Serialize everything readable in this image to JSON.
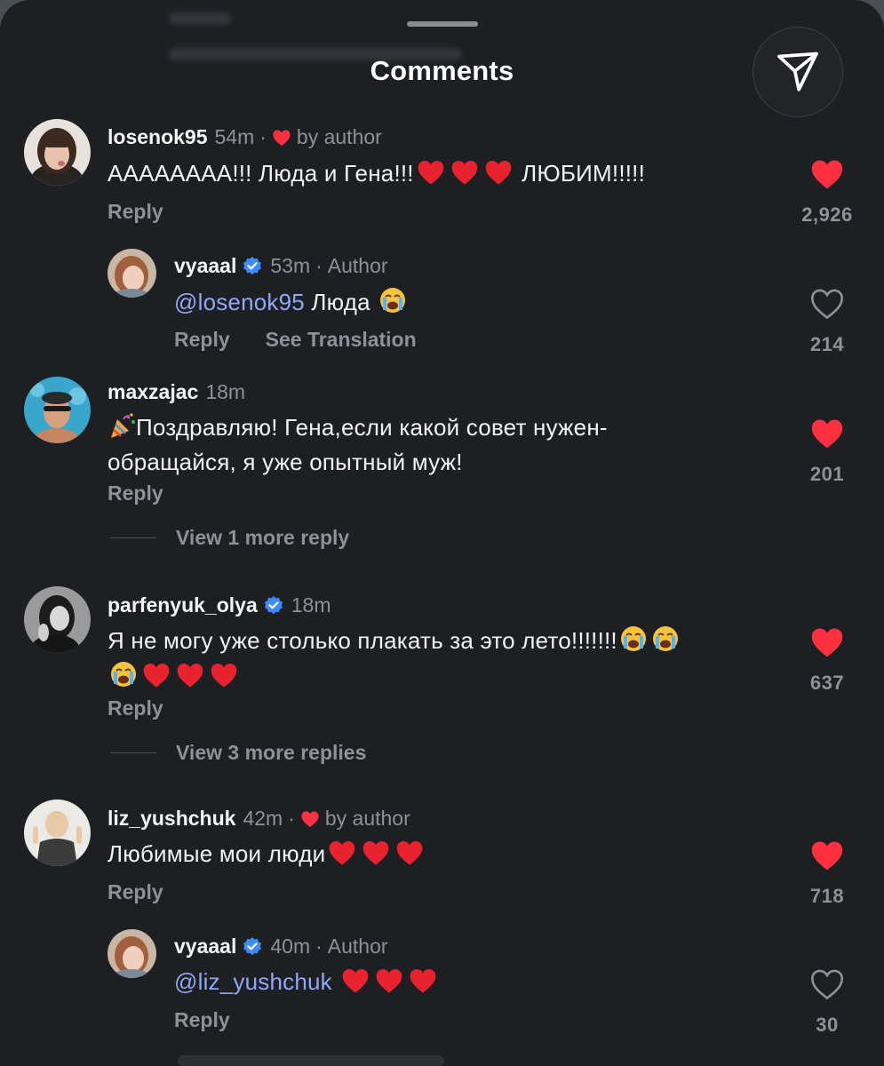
{
  "header": {
    "title": "Comments"
  },
  "share_icon": "send-icon",
  "comments": [
    {
      "username": "losenok95",
      "time": "54m",
      "liked_by_author": "by author",
      "text": "АААААААА!!! Люда и Гена!!!",
      "text_suffix": "ЛЮБИМ!!!!!",
      "emoji": [
        "red-heart",
        "red-heart",
        "red-heart"
      ],
      "reply_label": "Reply",
      "likes": "2,926",
      "liked": true
    },
    {
      "username": "vyaaal",
      "verified": true,
      "time": "53m",
      "badge": "Author",
      "mention": "@losenok95",
      "text": "Люда",
      "emoji": [
        "crying-face"
      ],
      "reply_label": "Reply",
      "translate_label": "See Translation",
      "likes": "214",
      "liked": false
    },
    {
      "username": "maxzajac",
      "time": "18m",
      "emoji": [
        "party-popper"
      ],
      "text_line1": "Поздравляю! Гена,если какой совет нужен-",
      "text_line2": "обращайся, я уже опытный муж!",
      "reply_label": "Reply",
      "likes": "201",
      "liked": true,
      "view_more": "View 1 more reply"
    },
    {
      "username": "parfenyuk_olya",
      "verified": true,
      "time": "18m",
      "text": "Я не могу уже столько плакать за это лето!!!!!!!",
      "emoji": [
        "crying-face",
        "crying-face",
        "crying-face",
        "red-heart",
        "red-heart",
        "red-heart"
      ],
      "reply_label": "Reply",
      "likes": "637",
      "liked": true,
      "view_more": "View 3 more replies"
    },
    {
      "username": "liz_yushchuk",
      "time": "42m",
      "liked_by_author": "by author",
      "text": "Любимые мои люди",
      "emoji": [
        "red-heart",
        "red-heart",
        "red-heart"
      ],
      "reply_label": "Reply",
      "likes": "718",
      "liked": true
    },
    {
      "username": "vyaaal",
      "verified": true,
      "time": "40m",
      "badge": "Author",
      "mention": "@liz_yushchuk",
      "emoji": [
        "red-heart",
        "red-heart",
        "red-heart"
      ],
      "reply_label": "Reply",
      "likes": "30",
      "liked": false
    }
  ],
  "colors": {
    "background": "#1d1f23",
    "text": "#f2f2f2",
    "muted": "#8e9196",
    "mention": "#8fa8f5",
    "like_red": "#ff3040",
    "verified_blue": "#3d8bfd"
  }
}
